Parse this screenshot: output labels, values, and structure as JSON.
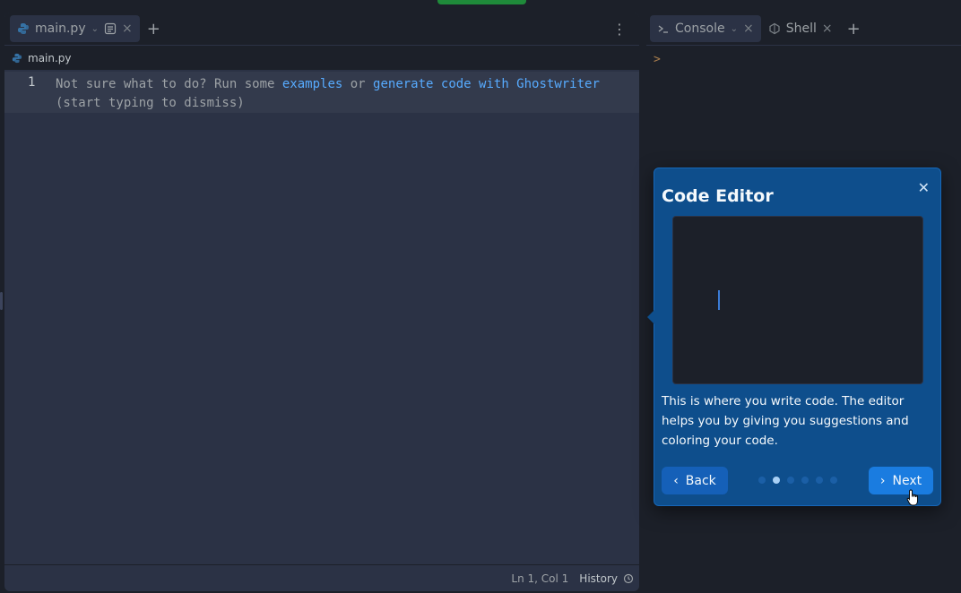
{
  "editor": {
    "tab_label": "main.py",
    "breadcrumb": "main.py",
    "line_number": "1",
    "hint_prefix": "Not sure what to do? Run some ",
    "hint_link1": "examples",
    "hint_mid": " or ",
    "hint_link2": "generate code with Ghostwriter",
    "hint_line2": "(start typing to dismiss)",
    "status_position": "Ln 1, Col 1",
    "status_history": "History"
  },
  "right": {
    "tabs": [
      {
        "label": "Console",
        "icon": "terminal-icon"
      },
      {
        "label": "Shell",
        "icon": "shell-icon"
      }
    ],
    "prompt": ">"
  },
  "tour": {
    "title": "Code Editor",
    "description": "This is where you write code. The editor helps you by giving you suggestions and coloring your code.",
    "back_label": "Back",
    "next_label": "Next",
    "steps_total": 6,
    "step_current": 2
  },
  "colors": {
    "accent": "#1a7ce0",
    "link": "#57abff",
    "tour_bg": "#0e4e8c"
  }
}
